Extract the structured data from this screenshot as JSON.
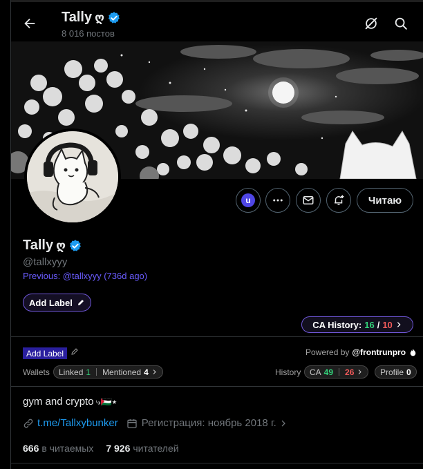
{
  "header": {
    "name": "Tally",
    "name_symbol": "ღ",
    "post_count": "8 016 постов"
  },
  "profile": {
    "name": "Tally",
    "name_symbol": "ღ",
    "handle": "@tallxyyy",
    "previous": "Previous: @tallxyyy (736d ago)",
    "follow_button": "Читаю",
    "avatar_badge_letter": "u"
  },
  "labels": {
    "add_label_primary": "Add Label",
    "add_label_secondary": "Add Label"
  },
  "ca_history": {
    "label": "CA History:",
    "good": "16",
    "separator": "/",
    "bad": "10"
  },
  "powered": {
    "prefix": "Powered by",
    "brand": "@frontrunpro"
  },
  "wallets": {
    "label": "Wallets",
    "linked_label": "Linked",
    "linked_count": "1",
    "mentioned_label": "Mentioned",
    "mentioned_count": "4"
  },
  "history": {
    "label": "History",
    "ca_label": "CA",
    "ca_good": "49",
    "ca_bad": "26",
    "profile_label": "Profile",
    "profile_count": "0"
  },
  "bio": {
    "text": "gym and crypto",
    "emoji_tail": "⤷🇵🇸⭑"
  },
  "meta": {
    "link": "t.me/Tallxybunker",
    "registration": "Регистрация: ноябрь 2018 г."
  },
  "stats": {
    "following_count": "666",
    "following_label": "в читаемых",
    "followers_count": "7 926",
    "followers_label": "читателей"
  },
  "colors": {
    "accent_link": "#1d9bf0",
    "verified": "#1d9bf0",
    "ca_good": "#33d17a",
    "ca_bad": "#f05a5a",
    "label_purple": "#6f57d8"
  }
}
